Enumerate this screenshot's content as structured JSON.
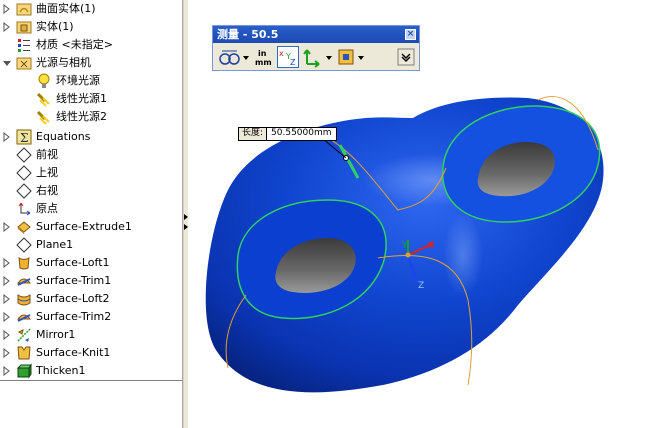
{
  "tree": {
    "items": [
      {
        "label": "曲面实体(1)",
        "icon": "surface-bodies-folder-icon"
      },
      {
        "label": "实体(1)",
        "icon": "solid-bodies-folder-icon"
      },
      {
        "label": "材质 <未指定>",
        "icon": "material-icon"
      },
      {
        "label": "光源与相机",
        "icon": "lights-cameras-folder-icon"
      },
      {
        "label": "环境光源",
        "icon": "ambient-light-icon"
      },
      {
        "label": "线性光源1",
        "icon": "directional-light-icon"
      },
      {
        "label": "线性光源2",
        "icon": "directional-light-icon"
      },
      {
        "label": "Equations",
        "icon": "equations-icon"
      },
      {
        "label": "前视",
        "icon": "plane-icon"
      },
      {
        "label": "上视",
        "icon": "plane-icon"
      },
      {
        "label": "右视",
        "icon": "plane-icon"
      },
      {
        "label": "原点",
        "icon": "origin-icon"
      },
      {
        "label": "Surface-Extrude1",
        "icon": "surface-extrude-icon"
      },
      {
        "label": "Plane1",
        "icon": "plane-icon"
      },
      {
        "label": "Surface-Loft1",
        "icon": "surface-loft-icon"
      },
      {
        "label": "Surface-Trim1",
        "icon": "surface-trim-icon"
      },
      {
        "label": "Surface-Loft2",
        "icon": "surface-loft-icon"
      },
      {
        "label": "Surface-Trim2",
        "icon": "surface-trim-icon"
      },
      {
        "label": "Mirror1",
        "icon": "mirror-icon"
      },
      {
        "label": "Surface-Knit1",
        "icon": "surface-knit-icon"
      },
      {
        "label": "Thicken1",
        "icon": "thicken-icon"
      }
    ]
  },
  "measure": {
    "title": "测量 - 50.5",
    "close": "×",
    "tools": [
      "arc-circle-measure-icon",
      "units-precision-icon",
      "xyz-measure-icon",
      "point-to-point-icon",
      "create-sensor-icon",
      "expand-icon"
    ],
    "units_line1": "in",
    "units_line2": "mm"
  },
  "dimension": {
    "label": "长度:",
    "value": "50.55000mm"
  },
  "triad": {
    "x": "X",
    "y": "Y",
    "z": "Z"
  },
  "colors": {
    "model_blue": "#0a36c0",
    "edge_green": "#30d060",
    "seam_orange": "#e0a030",
    "title_blue": "#1b49b0"
  }
}
